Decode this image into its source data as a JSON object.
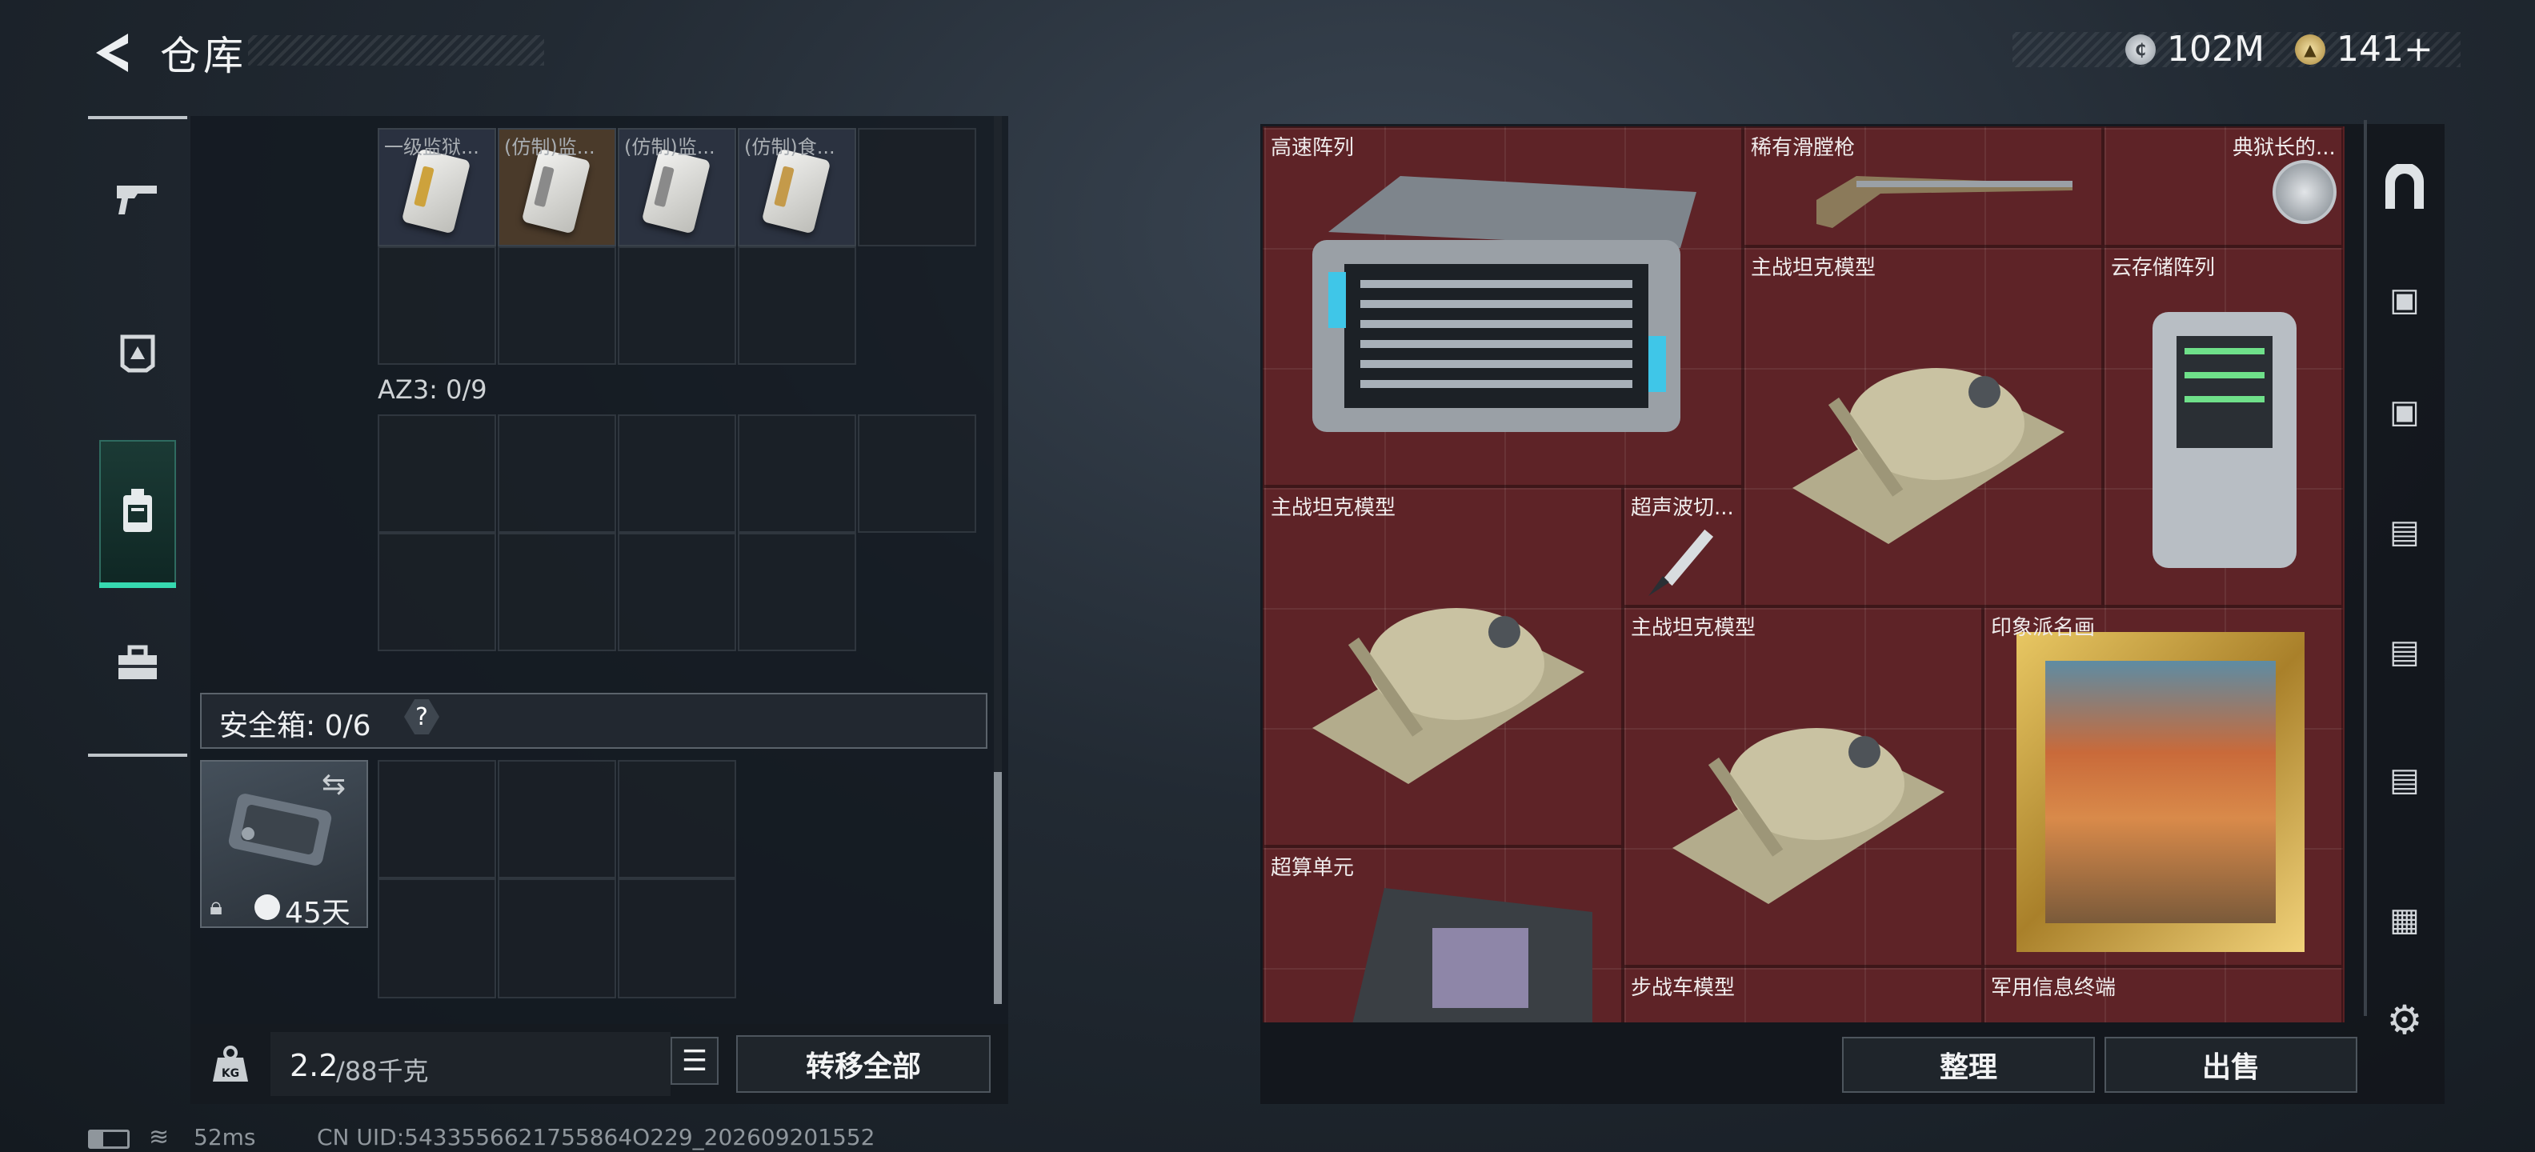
{
  "header": {
    "title": "仓库",
    "currency1": "102M",
    "currency2": "141+",
    "silver_icon": "silver-coin-icon",
    "gold_icon": "gold-coin-icon"
  },
  "sidebar": {
    "items": [
      {
        "icon": "gun-icon"
      },
      {
        "icon": "helmet-icon"
      },
      {
        "icon": "backpack-icon",
        "active": true
      },
      {
        "icon": "toolbox-icon"
      }
    ]
  },
  "left": {
    "top_items": [
      {
        "label": "一级监狱..."
      },
      {
        "label": "(仿制)监..."
      },
      {
        "label": "(仿制)监..."
      },
      {
        "label": "(仿制)食..."
      }
    ],
    "az3": "AZ3: 0/9",
    "safe_label": "安全箱: 0/6",
    "safe_help": "?",
    "safe_days": "45天",
    "weight_current": "2.2",
    "weight_max": "/88千克",
    "transfer_all": "转移全部"
  },
  "right": {
    "items": [
      {
        "label": "高速阵列"
      },
      {
        "label": "稀有滑膛枪"
      },
      {
        "label": "典狱长的..."
      },
      {
        "label": "主战坦克模型"
      },
      {
        "label": "云存储阵列"
      },
      {
        "label": "主战坦克模型"
      },
      {
        "label": "超声波切..."
      },
      {
        "label": "主战坦克模型"
      },
      {
        "label": "印象派名画"
      },
      {
        "label": "超算单元"
      },
      {
        "label": "步战车模型"
      },
      {
        "label": "军用信息终端"
      }
    ],
    "sort": "整理",
    "sell": "出售"
  },
  "status": {
    "ping": "52ms",
    "uid": "CN UID:5433556621755864O229_202609201552"
  }
}
